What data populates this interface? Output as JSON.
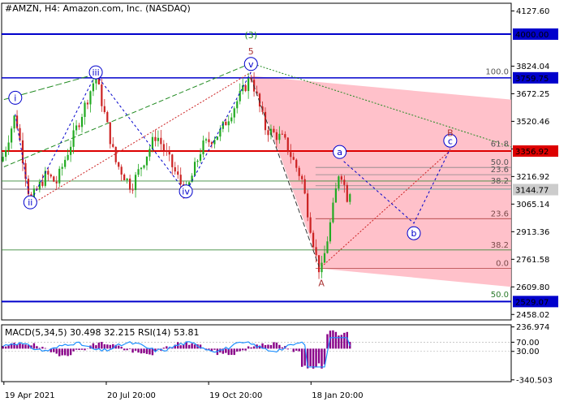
{
  "header": {
    "title": "#AMZN, H4:  Amazon.com, Inc. (NASDAQ)",
    "indicator": "MACD(5,34,5) 30.498 32.215 RSI(14) 53.81"
  },
  "chart_data": {
    "type": "candlestick",
    "price_axis": {
      "ylim": [
        2428,
        4170
      ],
      "ticks": [
        4127.6,
        3824.04,
        3672.25,
        3520.46,
        3368.67,
        3216.92,
        3065.14,
        2913.36,
        2761.58,
        2609.8,
        2458.02
      ],
      "tick_labels": [
        "4127.60",
        "3824.04",
        "3672.25",
        "3520.46",
        "",
        "3216.92",
        "3065.14",
        "2913.36",
        "2761.58",
        "2609.80",
        "2458.02"
      ]
    },
    "x_labels": [
      {
        "t": 0.5,
        "label": "19 Apr 2021"
      },
      {
        "t": 23.0,
        "label": "20 Jul 20:00"
      },
      {
        "t": 45.5,
        "label": "19 Oct 20:00"
      },
      {
        "t": 68.0,
        "label": "18 Jan 20:00"
      }
    ],
    "x_range": [
      0,
      112
    ],
    "levels": [
      {
        "price": 4000.0,
        "label": "4000.00",
        "color": "#0000cc",
        "width": 2
      },
      {
        "price": 3759.75,
        "label": "3759.75",
        "color": "#0000cc",
        "width": 1.5
      },
      {
        "price": 3356.92,
        "label": "3356.92",
        "color": "#dd0000",
        "width": 2
      },
      {
        "price": 3144.77,
        "label": "3144.77",
        "color": "#bbbbbb",
        "width": 1
      },
      {
        "price": 2529.07,
        "label": "2529.07",
        "color": "#0000cc",
        "width": 2
      }
    ],
    "fib_right": [
      {
        "price": 3368,
        "label": "61.8"
      },
      {
        "price": 3267,
        "label": "50.0"
      },
      {
        "price": 3227,
        "label": "23.6"
      },
      {
        "price": 3166,
        "label": "38.2"
      },
      {
        "price": 2985,
        "label": "23.6"
      },
      {
        "price": 2813,
        "label": "38.2"
      },
      {
        "price": 2711,
        "label": "0.0"
      },
      {
        "price": 3765,
        "label": "100.0"
      },
      {
        "price": 2539,
        "label": "50.0"
      }
    ],
    "waves": [
      {
        "t": 3,
        "p": 3650,
        "label": "i",
        "style": "circle",
        "color": "#0000cc"
      },
      {
        "t": 6.3,
        "p": 3075,
        "label": "ii",
        "style": "circle",
        "color": "#0000cc"
      },
      {
        "t": 20.7,
        "p": 3790,
        "label": "iii",
        "style": "circle",
        "color": "#0000cc"
      },
      {
        "t": 40.5,
        "p": 3135,
        "label": "iv",
        "style": "circle",
        "color": "#0000cc"
      },
      {
        "t": 54.8,
        "p": 3836,
        "label": "v",
        "style": "circle",
        "color": "#0000cc"
      },
      {
        "t": 74.3,
        "p": 3352,
        "label": "a",
        "style": "circle",
        "color": "#0000cc"
      },
      {
        "t": 90.6,
        "p": 2905,
        "label": "b",
        "style": "circle",
        "color": "#0000cc"
      },
      {
        "t": 98.6,
        "p": 3414,
        "label": "c",
        "style": "circle",
        "color": "#0000cc"
      },
      {
        "t": 54.8,
        "p": 4000,
        "label": "(3)",
        "style": "text",
        "color": "#228b22"
      },
      {
        "t": 54.8,
        "p": 3910,
        "label": "5",
        "style": "text",
        "color": "#aa3333"
      },
      {
        "t": 70.3,
        "p": 2636,
        "label": "A",
        "style": "text",
        "color": "#aa3333"
      },
      {
        "t": 98.6,
        "p": 3462,
        "label": "B",
        "style": "text",
        "color": "#aa3333"
      }
    ],
    "macd": {
      "ylim": [
        -360,
        260
      ],
      "ticks": [
        236.974,
        70.0,
        -30.0,
        -340.503
      ],
      "tick_labels": [
        "236.974",
        "70.00",
        "30.00",
        "-340.503"
      ]
    },
    "colors": {
      "bull": "#22aa22",
      "bear": "#cc2222",
      "zone": "#ffb6c1",
      "macd_hist": "#880088",
      "rsi": "#1e90ff"
    }
  }
}
